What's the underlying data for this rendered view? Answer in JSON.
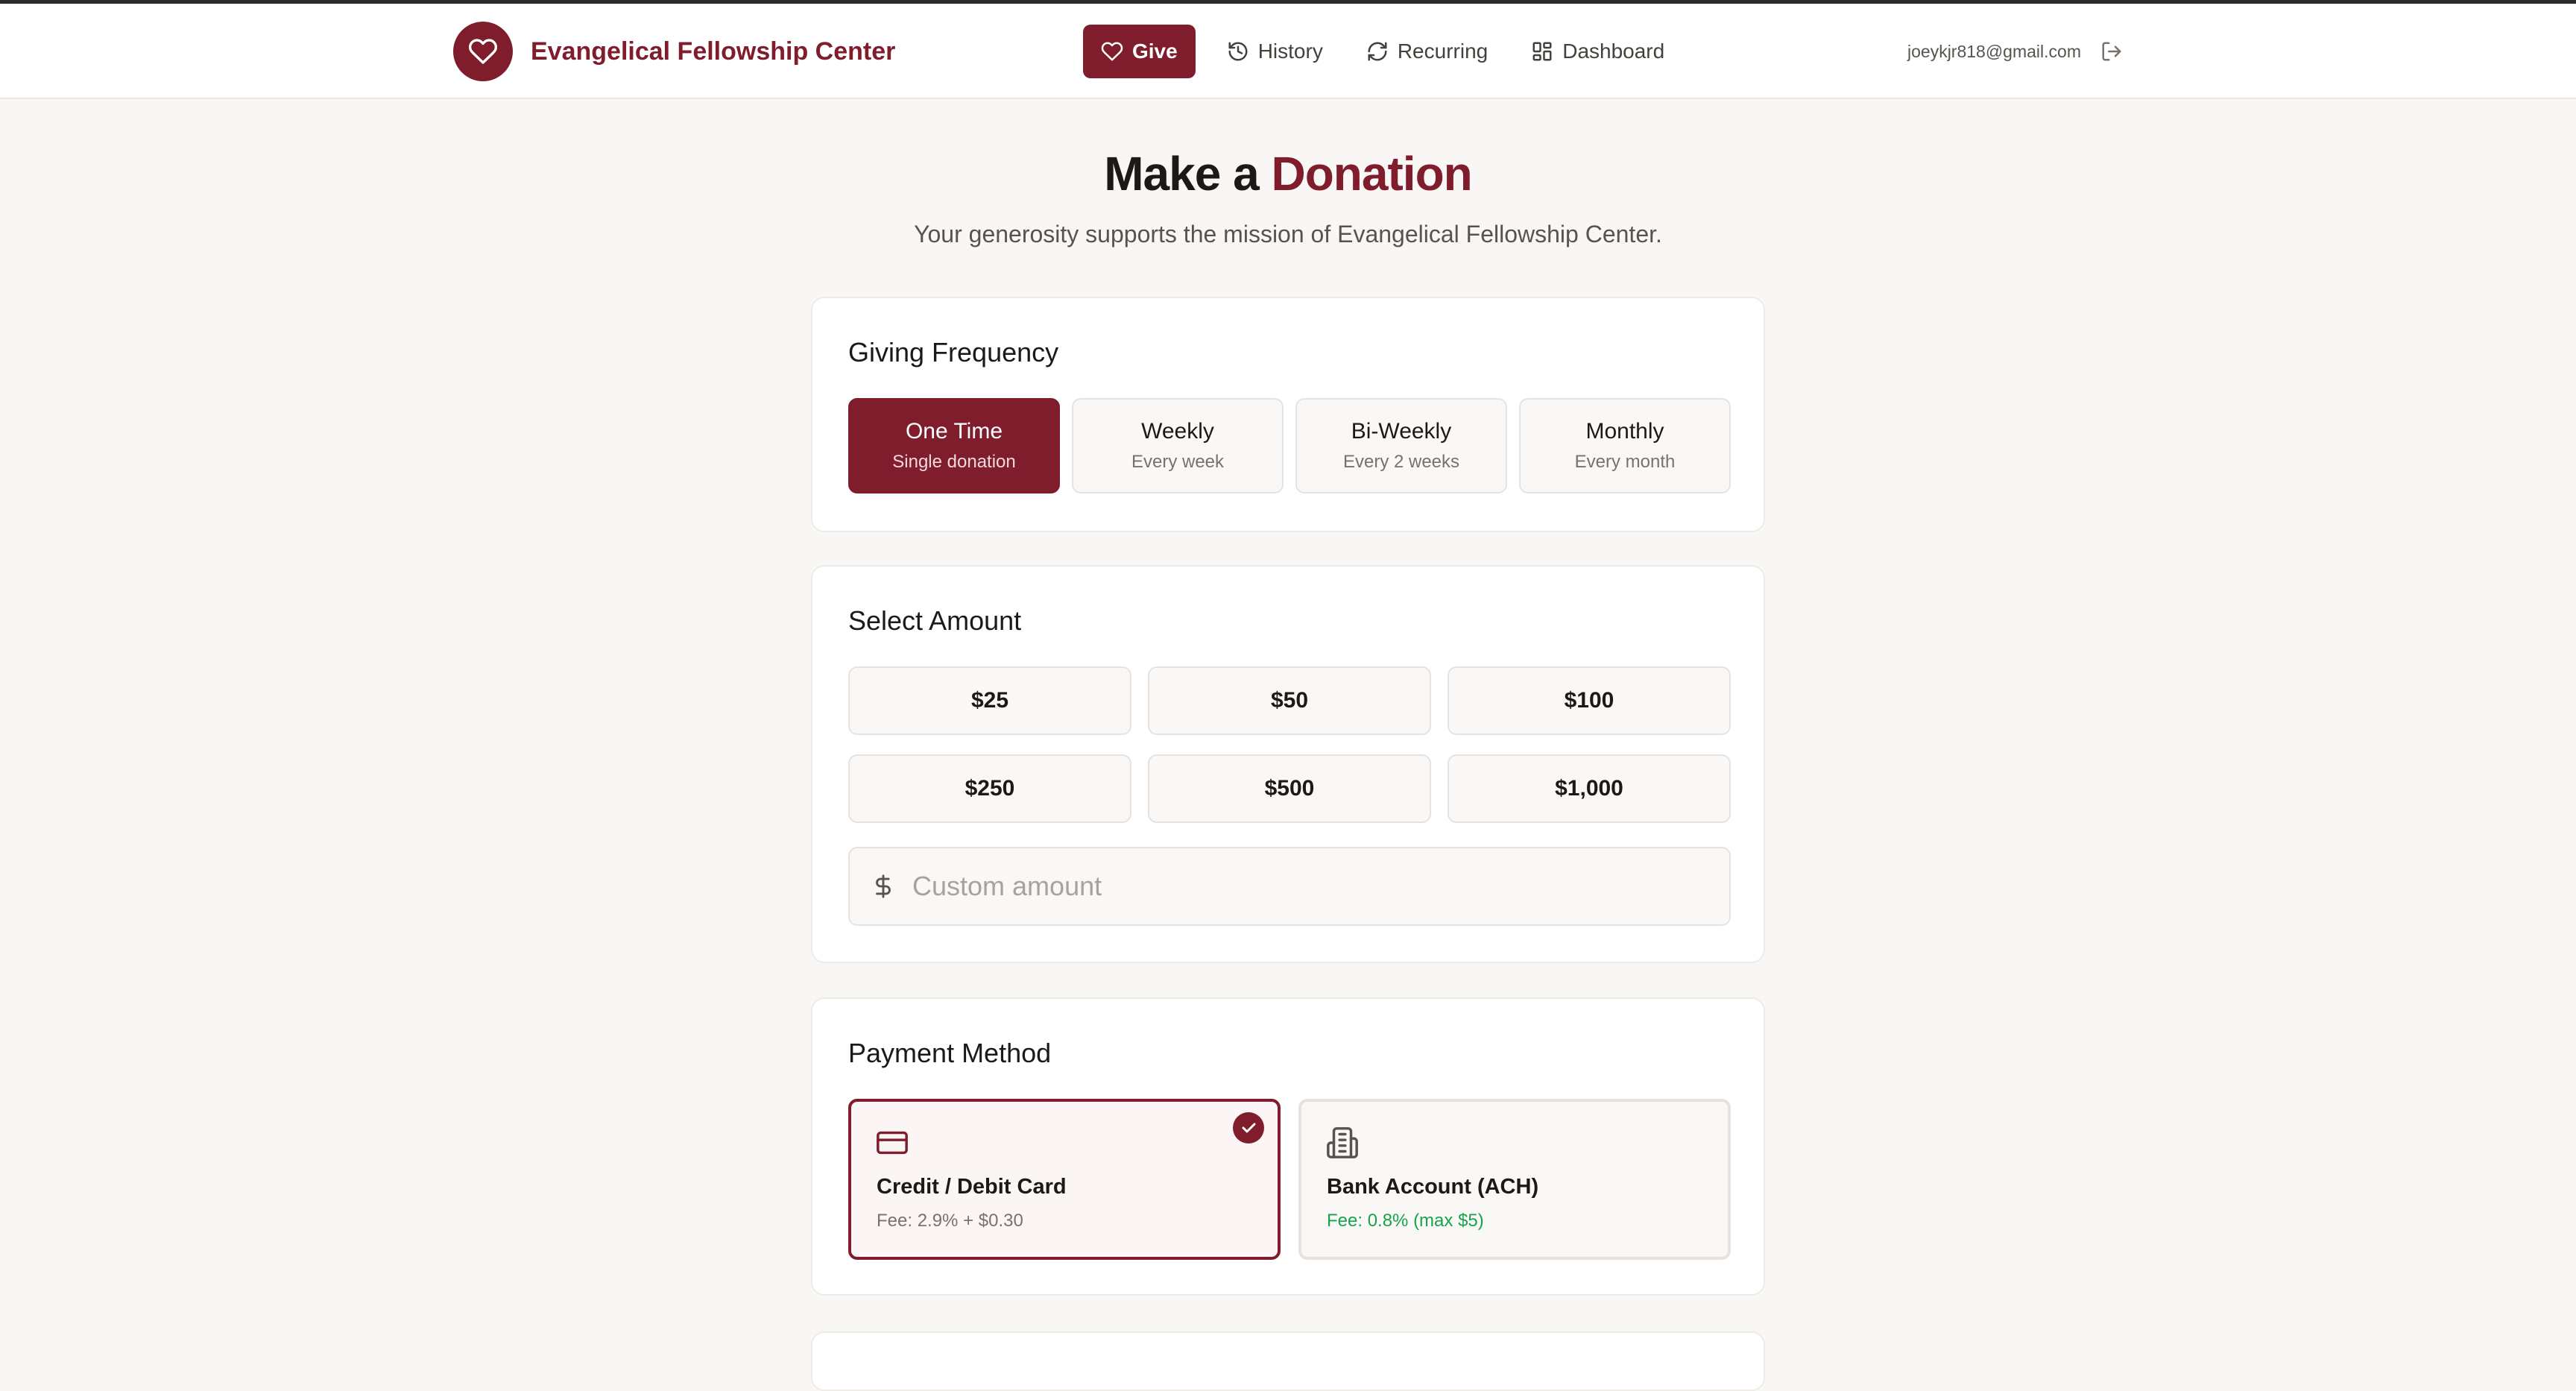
{
  "header": {
    "brand_name": "Evangelical Fellowship Center",
    "brand_icon": "heart-icon",
    "nav": [
      {
        "label": "Give",
        "icon": "heart-icon",
        "active": true
      },
      {
        "label": "History",
        "icon": "history-icon",
        "active": false
      },
      {
        "label": "Recurring",
        "icon": "refresh-icon",
        "active": false
      },
      {
        "label": "Dashboard",
        "icon": "grid-icon",
        "active": false
      }
    ],
    "user_email": "joeykjr818@gmail.com",
    "logout_icon": "logout-icon"
  },
  "page": {
    "title_prefix": "Make a",
    "title_accent": "Donation",
    "subtitle": "Your generosity supports the mission of Evangelical Fellowship Center."
  },
  "frequency": {
    "title": "Giving Frequency",
    "options": [
      {
        "label": "One Time",
        "sub": "Single donation",
        "selected": true
      },
      {
        "label": "Weekly",
        "sub": "Every week",
        "selected": false
      },
      {
        "label": "Bi-Weekly",
        "sub": "Every 2 weeks",
        "selected": false
      },
      {
        "label": "Monthly",
        "sub": "Every month",
        "selected": false
      }
    ]
  },
  "amount": {
    "title": "Select Amount",
    "options": [
      "$25",
      "$50",
      "$100",
      "$250",
      "$500",
      "$1,000"
    ],
    "custom_placeholder": "Custom amount",
    "custom_value": ""
  },
  "payment": {
    "title": "Payment Method",
    "options": [
      {
        "label": "Credit / Debit Card",
        "fee": "Fee: 2.9% + $0.30",
        "icon": "credit-card-icon",
        "selected": true
      },
      {
        "label": "Bank Account (ACH)",
        "fee": "Fee: 0.8% (max $5)",
        "icon": "bank-icon",
        "selected": false
      }
    ]
  },
  "colors": {
    "brand": "#7f1d2d",
    "background": "#f9f7f5",
    "success": "#16a34a"
  }
}
